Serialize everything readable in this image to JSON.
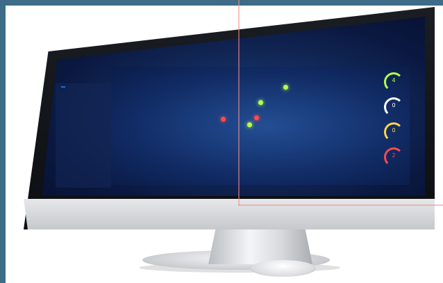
{
  "screen": {
    "title": "",
    "user_line": "",
    "date_line": "",
    "nav": [
      "",
      "",
      "",
      "",
      "",
      ""
    ],
    "sidebar": {
      "tab_active": "",
      "tab_inactive": "",
      "items": [
        "",
        "",
        "",
        "",
        "",
        "",
        "",
        ""
      ]
    },
    "gauges": [
      {
        "label": "",
        "value": "4",
        "color": "#b6ff4a"
      },
      {
        "label": "",
        "value": "0",
        "color": "#ffffff"
      },
      {
        "label": "",
        "value": "0",
        "color": "#ffd54a"
      },
      {
        "label": "",
        "value": "2",
        "color": "#ff4b4b"
      }
    ],
    "legend": ""
  }
}
